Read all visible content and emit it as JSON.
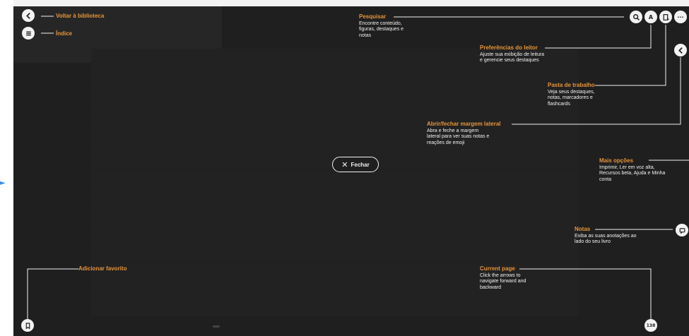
{
  "top_left": {
    "back_label": "Voltar à biblioteca",
    "index_label": "Índice"
  },
  "search": {
    "label": "Pesquisar",
    "description": "Encontre conteúdo, figuras, destaques e notas"
  },
  "reader_prefs": {
    "label": "Preferências do leitor",
    "description": "Ajuste sua exibição de leitura e gerencie seus destaques",
    "icon_text": "A"
  },
  "workbook": {
    "label": "Pasta de trabalho",
    "description": "Veja seus destaques, notas, marcadores e flashcards"
  },
  "margin": {
    "label": "Abrir/fechar margem lateral",
    "description": "Abra e feche a margem lateral para ver suas notas e reações de emoji"
  },
  "more": {
    "label": "Mais opções",
    "description": "Imprimir, Ler em voz alta, Recursos beta, Ajuda e Minha conta",
    "icon_text": "···"
  },
  "notes": {
    "label": "Notas",
    "description": "Exiba as suas anotações ao lado do seu livro"
  },
  "favorite": {
    "label": "Adicionar favorito"
  },
  "current_page": {
    "label": "Current page",
    "description": "Click the arrows to navigate forward and backward",
    "value": "138"
  },
  "close_button": {
    "label": "Fechar"
  },
  "colors": {
    "overlay": "#1f1f1f",
    "accent": "#e8953a",
    "text": "#f2f2f2",
    "link_arrow": "#3a8fd9"
  },
  "icons": [
    "chevron-left-icon",
    "list-icon",
    "search-icon",
    "text-settings-icon",
    "workbook-icon",
    "more-icon",
    "note-icon",
    "bookmark-icon",
    "close-icon"
  ]
}
